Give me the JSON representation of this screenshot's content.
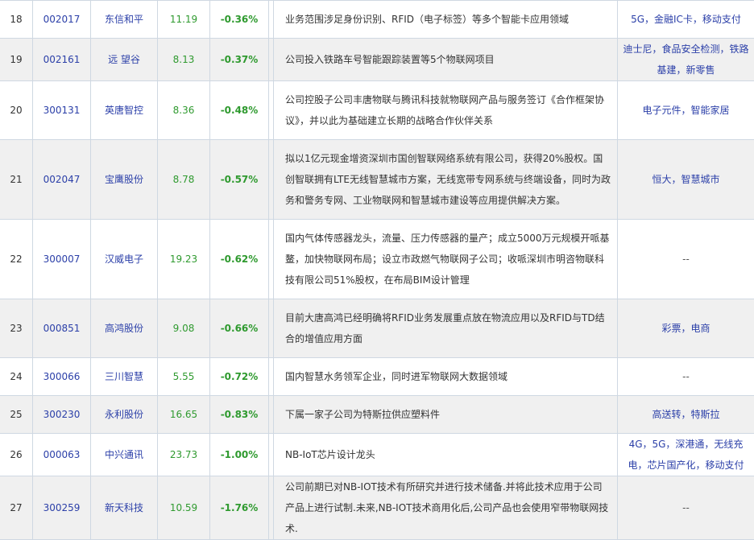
{
  "rows": [
    {
      "idx": "18",
      "code": "002017",
      "name": "东信和平",
      "price": "11.19",
      "change": "-0.36%",
      "desc": "业务范围涉足身份识别、RFID（电子标签）等多个智能卡应用领域",
      "tags": "5G，金融IC卡，移动支付"
    },
    {
      "idx": "19",
      "code": "002161",
      "name": "远 望谷",
      "price": "8.13",
      "change": "-0.37%",
      "desc": "公司投入铁路车号智能跟踪装置等5个物联网项目",
      "tags": "迪士尼，食品安全检测，铁路基建，新零售"
    },
    {
      "idx": "20",
      "code": "300131",
      "name": "英唐智控",
      "price": "8.36",
      "change": "-0.48%",
      "desc": "公司控股子公司丰唐物联与腾讯科技就物联网产品与服务签订《合作框架协议》，并以此为基础建立长期的战略合作伙伴关系",
      "tags": "电子元件，智能家居"
    },
    {
      "idx": "21",
      "code": "002047",
      "name": "宝鹰股份",
      "price": "8.78",
      "change": "-0.57%",
      "desc": "拟以1亿元现金增资深圳市国创智联网络系统有限公司，获得20%股权。国创智联拥有LTE无线智慧城市方案，无线宽带专网系统与终端设备，同时为政务和警务专网、工业物联网和智慧城市建设等应用提供解决方案。",
      "tags": "恒大，智慧城市"
    },
    {
      "idx": "22",
      "code": "300007",
      "name": "汉威电子",
      "price": "19.23",
      "change": "-0.62%",
      "desc": "国内气体传感器龙头，流量、压力传感器的量产；成立5000万元规模开哌基鳌，加快物联网布局；设立市政燃气物联网子公司；收哌深圳市明咨物联科技有限公司51%股权，在布局BIM设计管理",
      "tags": "--"
    },
    {
      "idx": "23",
      "code": "000851",
      "name": "高鸿股份",
      "price": "9.08",
      "change": "-0.66%",
      "desc": "目前大唐高鸿已经明确将RFID业务发展重点放在物流应用以及RFID与TD结合的增值应用方面",
      "tags": "彩票，电商"
    },
    {
      "idx": "24",
      "code": "300066",
      "name": "三川智慧",
      "price": "5.55",
      "change": "-0.72%",
      "desc": "国内智慧水务领军企业，同时进军物联网大数据领域",
      "tags": "--"
    },
    {
      "idx": "25",
      "code": "300230",
      "name": "永利股份",
      "price": "16.65",
      "change": "-0.83%",
      "desc": "下属一家子公司为特斯拉供应塑料件",
      "tags": "高送转，特斯拉"
    },
    {
      "idx": "26",
      "code": "000063",
      "name": "中兴通讯",
      "price": "23.73",
      "change": "-1.00%",
      "desc": "NB-IoT芯片设计龙头",
      "tags": "4G，5G，深港通，无线充电，芯片国产化，移动支付"
    },
    {
      "idx": "27",
      "code": "300259",
      "name": "新天科技",
      "price": "10.59",
      "change": "-1.76%",
      "desc": "公司前期已对NB-IOT技术有所研究并进行技术储备.并将此技术应用于公司产品上进行试制.未来,NB-IOT技术商用化后,公司产品也会使用窄带物联网技术.",
      "tags": "--"
    }
  ]
}
